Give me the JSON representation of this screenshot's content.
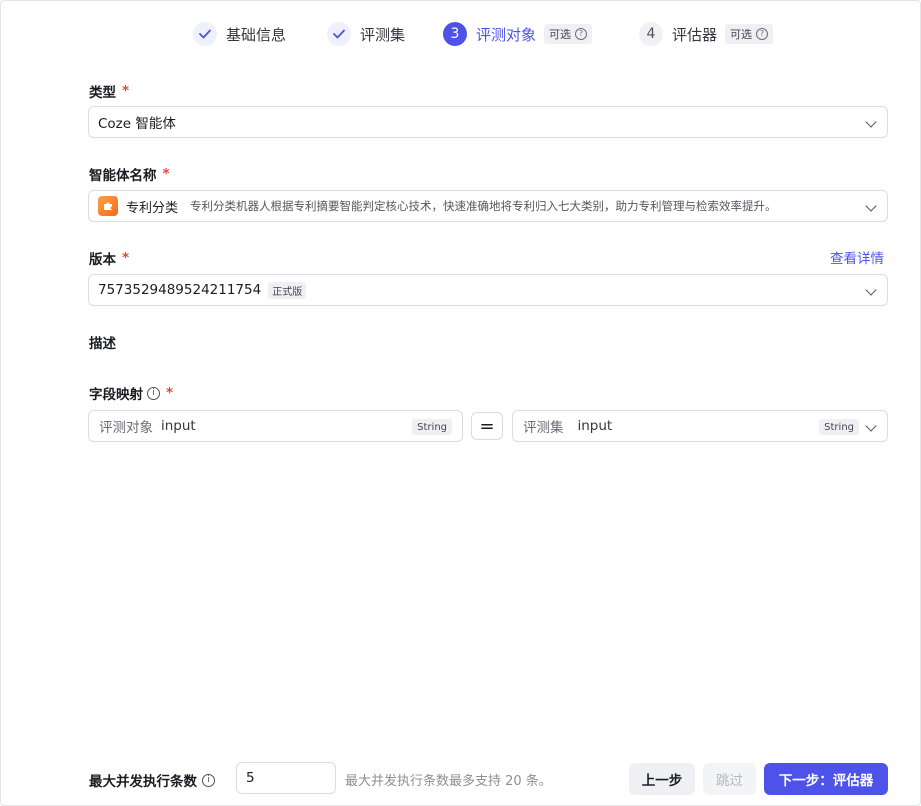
{
  "stepper": {
    "steps": [
      {
        "label": "基础信息",
        "status": "done"
      },
      {
        "label": "评测集",
        "status": "done"
      },
      {
        "label": "评测对象",
        "number": "3",
        "status": "active",
        "optional_label": "可选"
      },
      {
        "label": "评估器",
        "number": "4",
        "status": "todo",
        "optional_label": "可选"
      }
    ]
  },
  "form": {
    "type": {
      "label": "类型",
      "required_mark": "*",
      "value": "Coze 智能体"
    },
    "agent": {
      "label": "智能体名称",
      "required_mark": "*",
      "name": "专利分类",
      "description": "专利分类机器人根据专利摘要智能判定核心技术，快速准确地将专利归入七大类别，助力专利管理与检索效率提升。"
    },
    "version": {
      "label": "版本",
      "required_mark": "*",
      "value": "7573529489524211754",
      "badge": "正式版",
      "detail_link": "查看详情"
    },
    "description": {
      "label": "描述"
    },
    "field_mapping": {
      "label": "字段映射",
      "required_mark": "*",
      "info_icon": "i",
      "left": {
        "prefix": "评测对象",
        "name": "input",
        "type": "String"
      },
      "equals": "=",
      "right": {
        "prefix": "评测集",
        "name": "input",
        "type": "String"
      }
    }
  },
  "footer": {
    "concurrency_label": "最大并发执行条数",
    "info_icon": "i",
    "concurrency_value": "5",
    "hint": "最大并发执行条数最多支持 20 条。",
    "prev_label": "上一步",
    "skip_label": "跳过",
    "next_label": "下一步：评估器"
  },
  "colors": {
    "accent": "#4d53e8",
    "required": "#e5452f"
  }
}
